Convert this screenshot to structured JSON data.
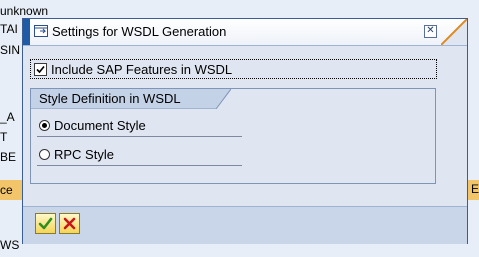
{
  "background": {
    "texts": [
      "unknown",
      "TAI",
      "SIN",
      "_A",
      "T",
      "BE",
      "ce",
      "WS"
    ],
    "right_edge_text": "E"
  },
  "dialog": {
    "title": "Settings for WSDL Generation",
    "include_sap_features": {
      "label": "Include SAP Features in WSDL",
      "checked": true
    },
    "style_group": {
      "title": "Style Definition in WSDL",
      "options": [
        {
          "label": "Document Style",
          "selected": true
        },
        {
          "label": "RPC Style",
          "selected": false
        }
      ]
    },
    "buttons": {
      "confirm_icon": "check-icon",
      "cancel_icon": "cancel-x-icon"
    }
  },
  "colors": {
    "accent_blue": "#1f5aa6",
    "dialog_bg": "#dfe6f1",
    "warning_strip": "#f2c56a"
  }
}
